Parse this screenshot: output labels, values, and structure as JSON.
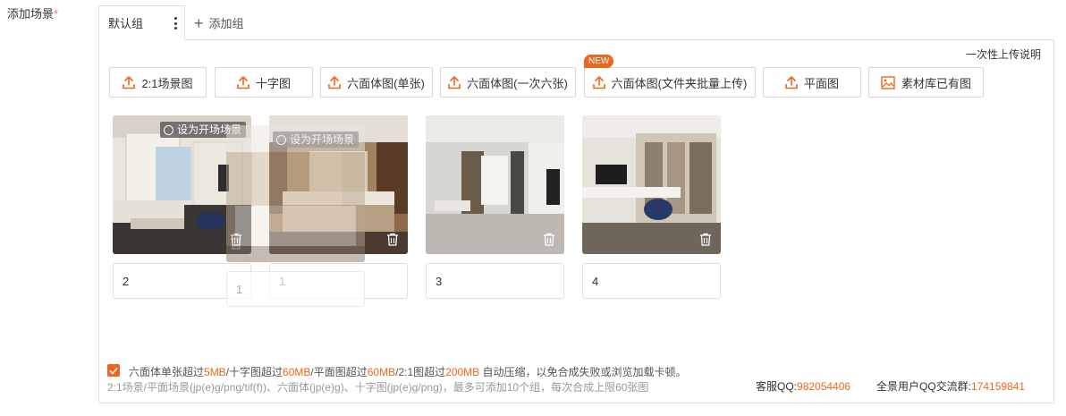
{
  "field": {
    "label": "添加场景",
    "required_mark": "*"
  },
  "tabs": {
    "active_label": "默认组",
    "add_label": "添加组"
  },
  "upload_note": "一次性上传说明",
  "buttons": [
    {
      "label": "2:1场景图",
      "icon": "upload-icon"
    },
    {
      "label": "十字图",
      "icon": "upload-icon"
    },
    {
      "label": "六面体图(单张)",
      "icon": "upload-icon"
    },
    {
      "label": "六面体图(一次六张)",
      "icon": "upload-icon"
    },
    {
      "label": "六面体图(文件夹批量上传)",
      "icon": "upload-icon"
    },
    {
      "label": "平面图",
      "icon": "upload-icon"
    },
    {
      "label": "素材库已有图",
      "icon": "image-icon"
    }
  ],
  "new_badge": "NEW",
  "scenes": [
    {
      "name": "2",
      "set_start_label": "设为开场场景"
    },
    {
      "name": "1",
      "set_start_label": "设为开场场景"
    },
    {
      "name": "3"
    },
    {
      "name": "4"
    }
  ],
  "drag_ghost": {
    "name": "1"
  },
  "footer": {
    "line1": [
      "六面体单张超过",
      "5MB",
      "/十字图超过",
      "60MB",
      "/平面图超过",
      "60MB",
      "/2:1图超过",
      "200MB",
      " 自动压缩，以免合成失败或浏览加载卡顿。"
    ],
    "line2": "2:1场景/平面场景(jp(e)g/png/tif(f))、六面体(jp(e)g)、十字图(jp(e)g/png)，最多可添加10个组，每次合成上限60张图",
    "qq_label": "客服QQ:",
    "qq_value": "982054406",
    "group_label": "全景用户QQ交流群:",
    "group_value": "174159841"
  },
  "colors": {
    "accent": "#f0661d",
    "border": "#dcdfe6"
  }
}
